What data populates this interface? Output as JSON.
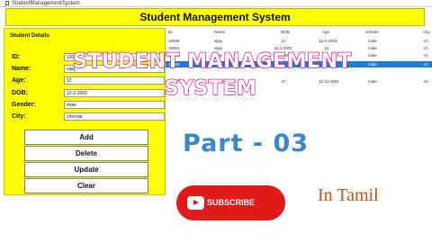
{
  "window": {
    "title": "StudentManagementSystem"
  },
  "app": {
    "heading": "Student Management System"
  },
  "details": {
    "legend": "Student Details",
    "fields": [
      {
        "label": "ID:",
        "value": "10008"
      },
      {
        "label": "Name:",
        "value": "vijay"
      },
      {
        "label": "Age:",
        "value": "12"
      },
      {
        "label": "DOB:",
        "value": "12-2-2003"
      },
      {
        "label": "Gender:",
        "value": "male"
      },
      {
        "label": "City:",
        "value": "chennai"
      }
    ]
  },
  "buttons": {
    "add": "Add",
    "delete": "Delete",
    "update": "Update",
    "clear": "Clear"
  },
  "table": {
    "columns": [
      "ID",
      "Name",
      "DOB",
      "Age",
      "Gender",
      "City"
    ],
    "rows": [
      [
        "10006",
        "vijay",
        "12",
        "12-2-2003",
        "male",
        "ch"
      ],
      [
        "10002",
        "vijay",
        "16-4-2003",
        "13",
        "male",
        "ch"
      ],
      [
        "10001",
        "vijay",
        "16-4-2003",
        "12",
        "male",
        "ch"
      ],
      [
        "10000",
        "vijay",
        "",
        "",
        "male",
        "ch"
      ],
      [
        "10007",
        "vijayasankar",
        "17",
        "12-12-2001",
        "male",
        "ch"
      ]
    ],
    "selected_row": 3
  },
  "overlay": {
    "title_line1": "STUDENT MANAGEMENT",
    "title_line2": "SYSTEM",
    "part": "Part - 03",
    "subscribe": "SUBSCRIBE",
    "language": "In Tamil"
  },
  "colors": {
    "accent_yellow": "#ffff00",
    "subscribe_red": "#e11a1a",
    "title_pink": "#e0188e",
    "part_blue": "#3a87c9",
    "selection_blue": "#1e7bd6"
  }
}
